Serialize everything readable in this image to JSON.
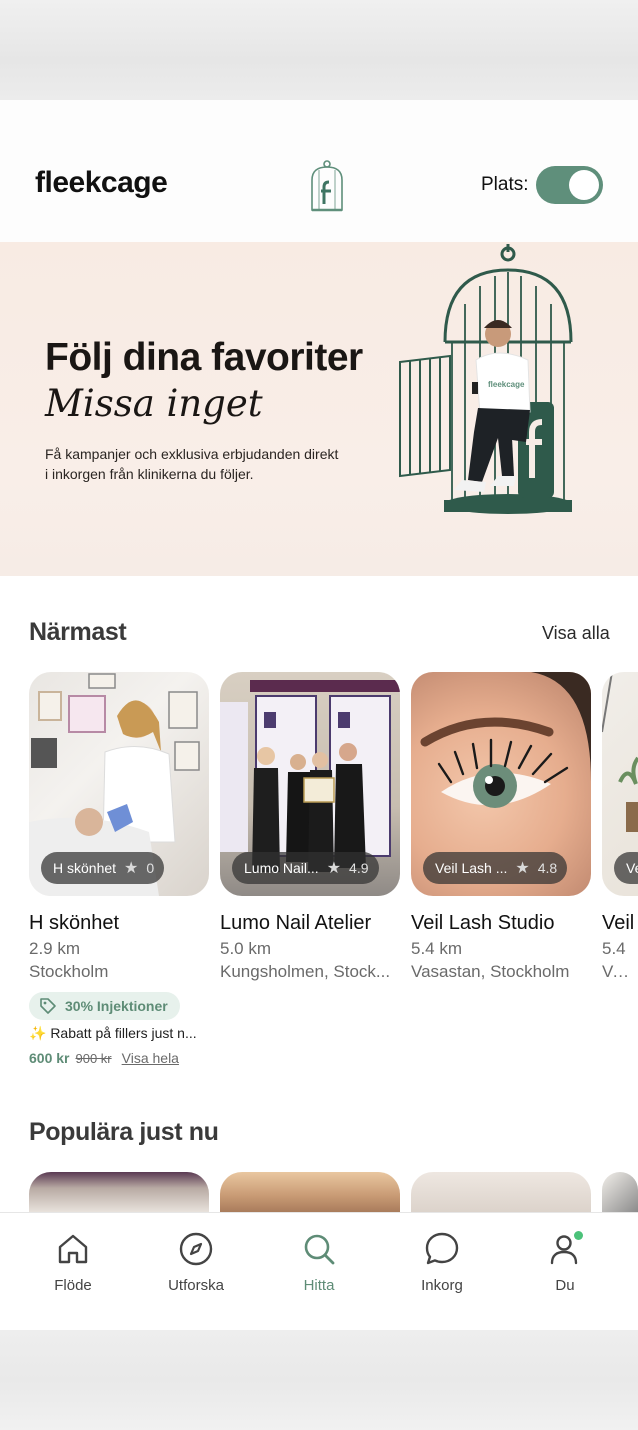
{
  "header": {
    "logo": "fleekcage",
    "location_label": "Plats:",
    "location_toggle_on": true
  },
  "hero": {
    "title": "Följ dina favoriter",
    "subtitle": "Missa inget",
    "description": "Få kampanjer och exklusiva erbjudanden direkt i inkorgen från klinikerna du följer.",
    "shirt_text": "fleekcage"
  },
  "nearest": {
    "title": "Närmast",
    "see_all": "Visa alla",
    "cards": [
      {
        "pill_name": "H skönhet",
        "rating": "0",
        "name": "H skönhet",
        "distance": "2.9 km",
        "location": "Stockholm"
      },
      {
        "pill_name": "Lumo Nail...",
        "rating": "4.9",
        "name": "Lumo Nail Atelier",
        "distance": "5.0 km",
        "location": "Kungsholmen, Stock..."
      },
      {
        "pill_name": "Veil Lash ...",
        "rating": "4.8",
        "name": "Veil Lash Studio",
        "distance": "5.4 km",
        "location": "Vasastan, Stockholm"
      },
      {
        "pill_name": "Ve",
        "rating": "",
        "name": "Veil",
        "distance": "5.4",
        "location": "Vasa"
      }
    ],
    "promo": {
      "badge": "30% Injektioner",
      "text": "✨ Rabatt på fillers just n...",
      "price_new": "600 kr",
      "price_old": "900 kr",
      "show_full": "Visa hela"
    }
  },
  "popular": {
    "title": "Populära just nu"
  },
  "nav": {
    "items": [
      {
        "label": "Flöde",
        "icon": "home-icon"
      },
      {
        "label": "Utforska",
        "icon": "compass-icon"
      },
      {
        "label": "Hitta",
        "icon": "search-icon"
      },
      {
        "label": "Inkorg",
        "icon": "chat-icon"
      },
      {
        "label": "Du",
        "icon": "user-icon"
      }
    ],
    "active": "Hitta"
  },
  "colors": {
    "accent": "#5f8f7b",
    "hero_bg": "#f8ebe3",
    "notification_dot": "#4cc27a"
  }
}
